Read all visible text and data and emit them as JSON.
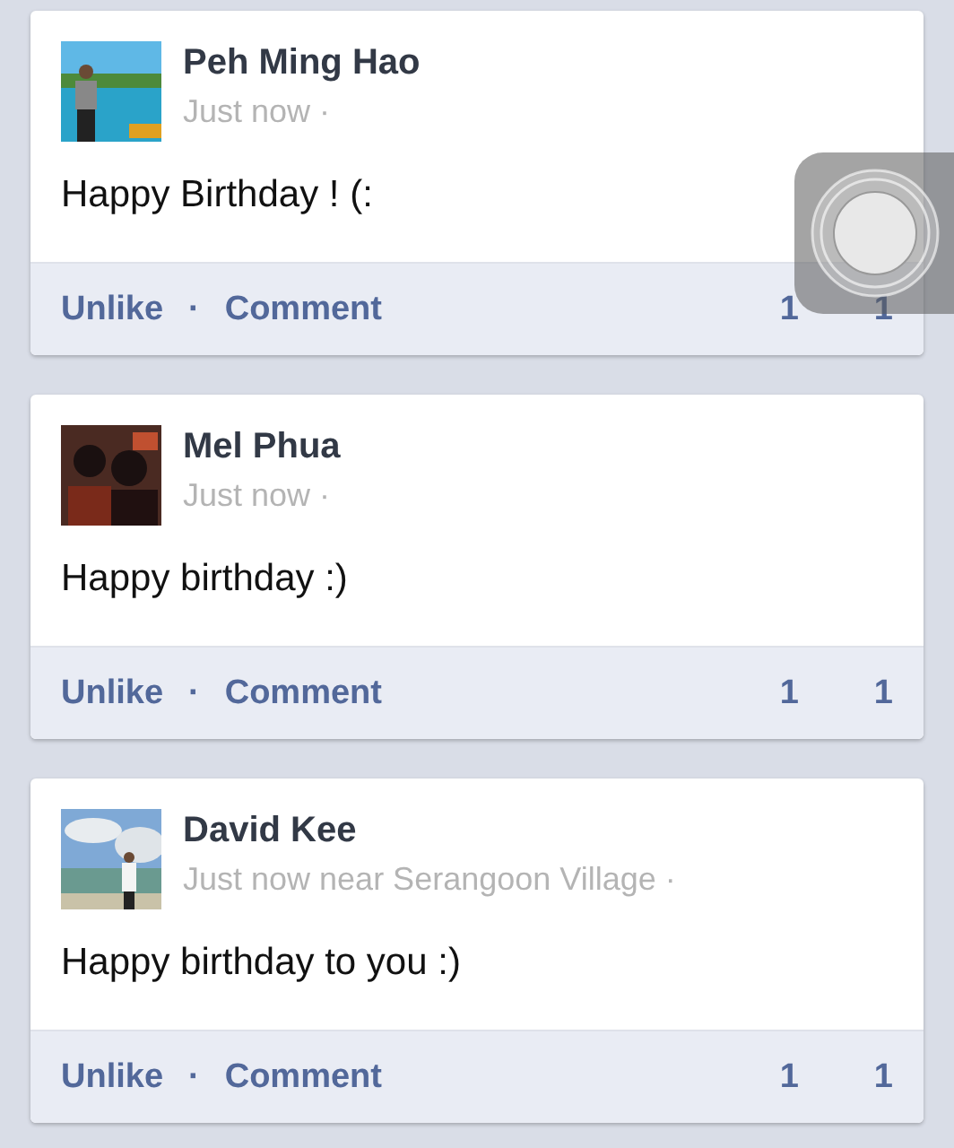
{
  "posts": [
    {
      "author": "Peh Ming Hao",
      "meta": "Just now ·",
      "message": "Happy Birthday ! (:",
      "actions": [
        "Unlike",
        "·",
        "Comment"
      ],
      "likes": "1",
      "comments": "1"
    },
    {
      "author": "Mel Phua",
      "meta": "Just now ·",
      "message": "Happy birthday :)",
      "actions": [
        "Unlike",
        "·",
        "Comment"
      ],
      "likes": "1",
      "comments": "1"
    },
    {
      "author": "David Kee",
      "meta": "Just now near Serangoon Village ·",
      "message": "Happy birthday to you :)",
      "actions": [
        "Unlike",
        "·",
        "Comment"
      ],
      "likes": "1",
      "comments": "1"
    }
  ]
}
